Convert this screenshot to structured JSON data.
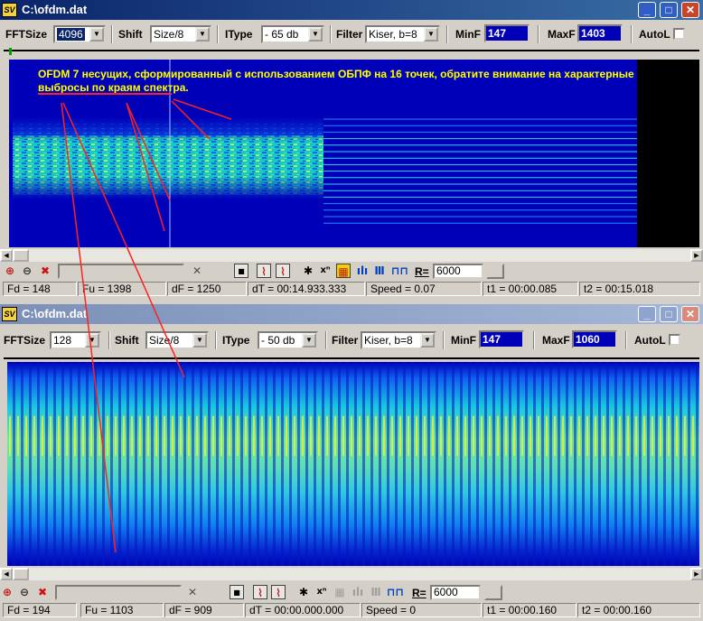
{
  "colors": {
    "spectrogram_bg": "#0000b8",
    "annotation": "#ffff00",
    "arrow": "#ff2020",
    "title_active": "#0a246a"
  },
  "window1": {
    "app_icon": "SV",
    "title": "C:\\ofdm.dat",
    "controls": {
      "fftsize_label": "FFTSize",
      "fftsize_value": "4096",
      "shift_label": "Shift",
      "shift_value": "Size/8",
      "itype_label": "IType",
      "itype_value": "- 65 db",
      "filter_label": "Filter",
      "filter_value": "Kiser, b=8",
      "minf_label": "MinF",
      "minf_value": "147",
      "maxf_label": "MaxF",
      "maxf_value": "1403",
      "autol_label": "AutoL"
    },
    "annotation": "OFDM 7 несущих, сформированный с использованием ОБПФ на 16 точек, обратите внимание на характерные выбросы по краям спектра.",
    "r_label": "R=",
    "r_value": "6000",
    "status": {
      "fd": "Fd = 148",
      "fu": "Fu = 1398",
      "df": "dF = 1250",
      "dt": "dT = 00:14.933.333",
      "speed": "Speed = 0.07",
      "t1": "t1 = 00:00.085",
      "t2": "t2 = 00:15.018"
    }
  },
  "window2": {
    "app_icon": "SV",
    "title": "C:\\ofdm.dat",
    "controls": {
      "fftsize_label": "FFTSize",
      "fftsize_value": "128",
      "shift_label": "Shift",
      "shift_value": "Size/8",
      "itype_label": "IType",
      "itype_value": "- 50 db",
      "filter_label": "Filter",
      "filter_value": "Kiser, b=8",
      "minf_label": "MinF",
      "minf_value": "147",
      "maxf_label": "MaxF",
      "maxf_value": "1060",
      "autol_label": "AutoL"
    },
    "r_label": "R=",
    "r_value": "6000",
    "status": {
      "fd": "Fd = 194",
      "fu": "Fu = 1103",
      "df": "dF = 909",
      "dt": "dT = 00:00.000.000",
      "speed": "Speed = 0",
      "t1": "t1 = 00:00.160",
      "t2": "t2 = 00:00.160"
    }
  },
  "icons": [
    "zoom-in-icon",
    "zoom-out-icon",
    "zoom-reset-icon",
    "cross-tool-icon",
    "stop-icon",
    "graph-icon",
    "graph-alt-icon",
    "star-icon",
    "power-icon",
    "color-map-icon",
    "bar-chart-icon",
    "comb-icon",
    "pulse-icon"
  ]
}
